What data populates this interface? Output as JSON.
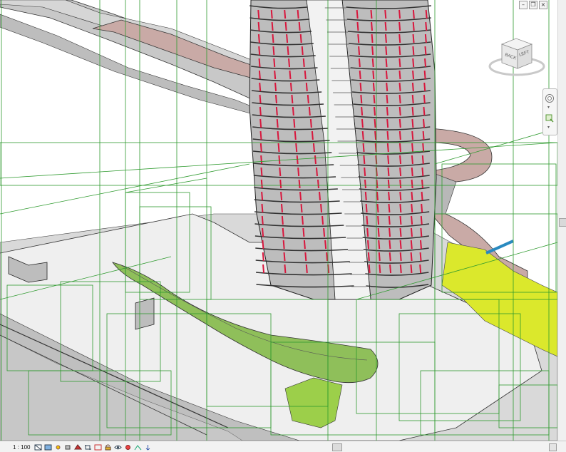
{
  "viewcube": {
    "face_back": "BACK",
    "face_left": "LEFT"
  },
  "status_bar": {
    "scale": "1 : 100",
    "icons": [
      "detail-level-icon",
      "visual-style-icon",
      "sun-path-icon",
      "shadows-icon",
      "render-icon",
      "crop-icon",
      "show-crop-icon",
      "unlock-3d-icon",
      "temporary-hide-icon",
      "reveal-hidden-icon",
      "analytical-model-icon",
      "highlight-icon"
    ]
  },
  "window_controls": [
    "minimize-icon",
    "restore-icon",
    "close-icon"
  ],
  "colors": {
    "model_gray": "#bdbdbd",
    "floor_white": "#ececec",
    "bridge_pink": "#c9aaa6",
    "facade_red": "#d8173d",
    "green_roof": "#8fbf5a",
    "yellow_highlight": "#dbe82c",
    "bbox_green": "#2e9a2e"
  }
}
